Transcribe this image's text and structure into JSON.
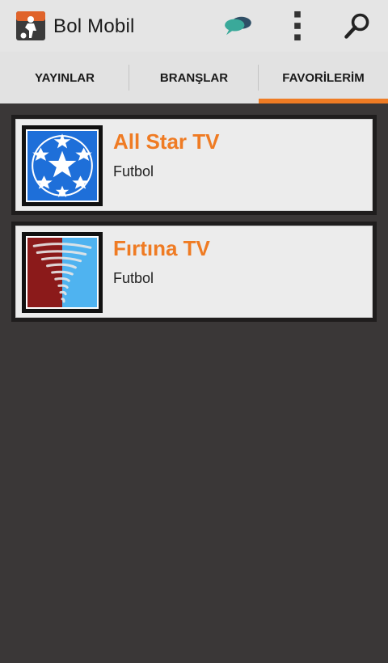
{
  "appbar": {
    "title": "Bol Mobil",
    "actions": [
      {
        "icon": "chat-bubbles-icon"
      },
      {
        "icon": "overflow-menu-icon"
      },
      {
        "icon": "search-icon"
      }
    ]
  },
  "tabs": [
    {
      "label": "YAYINLAR",
      "active": false
    },
    {
      "label": "BRANŞLAR",
      "active": false
    },
    {
      "label": "FAVORİLERİM",
      "active": true
    }
  ],
  "favorites": [
    {
      "title": "All Star TV",
      "subtitle": "Futbol",
      "logo": "starball-logo"
    },
    {
      "title": "Fırtına TV",
      "subtitle": "Futbol",
      "logo": "tornado-logo"
    }
  ],
  "colors": {
    "accent": "#ef7b23",
    "background": "#3a3737",
    "appbar": "#e5e5e5"
  }
}
